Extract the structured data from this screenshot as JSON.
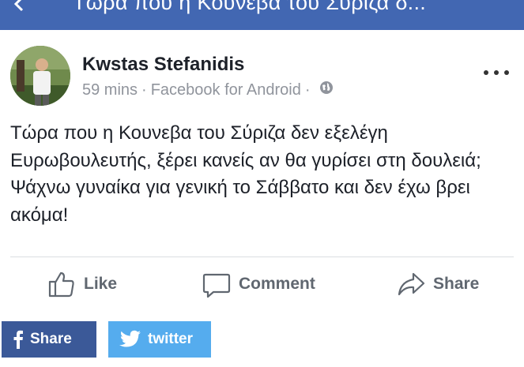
{
  "header": {
    "title": "Τώρα που η Κουνέβα του Σύριζα δ...",
    "back_icon": "back-arrow-icon",
    "color": "#4267b2"
  },
  "post": {
    "author": "Kwstas Stefanidis",
    "time": "59 mins",
    "separator": "·",
    "source": "Facebook for Android",
    "privacy_icon": "globe-icon",
    "body": "Τώρα που η Κουνεβα του Σύριζα δεν εξελέγη Ευρωβουλευτής, ξέρει κανείς αν θα γυρίσει στη δουλειά; Ψάχνω γυναίκα για γενική το Σάββατο και δεν έχω βρει ακόμα!"
  },
  "actions": {
    "like": "Like",
    "comment": "Comment",
    "share": "Share"
  },
  "share_buttons": {
    "facebook": "Share",
    "twitter": "twitter",
    "facebook_color": "#3b5998",
    "twitter_color": "#55acee"
  }
}
